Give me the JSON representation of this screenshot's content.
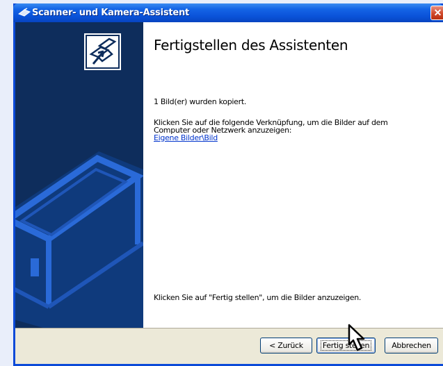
{
  "window": {
    "title": "Scanner- und Kamera-Assistent",
    "close_glyph": "✕",
    "icon": "scanner-camera-icon"
  },
  "content": {
    "heading": "Fertigstellen des Assistenten",
    "copied_text": "1 Bild(er) wurden kopiert.",
    "instruction_line1": "Klicken Sie auf die folgende Verknüpfung, um die Bilder auf dem",
    "instruction_line2": "Computer oder Netzwerk anzuzeigen:",
    "link": "Eigene Bilder\\Bild",
    "finish_hint": "Klicken Sie auf \"Fertig stellen\", um die Bilder anzuzeigen."
  },
  "buttons": {
    "back": "< Zurück",
    "finish": "Fertig stellen",
    "cancel": "Abbrechen"
  },
  "colors": {
    "title_bar": "#0a52d8",
    "left_panel": "#0e2d5c",
    "dialog_footer": "#ece9d8",
    "link": "#0033cc"
  }
}
